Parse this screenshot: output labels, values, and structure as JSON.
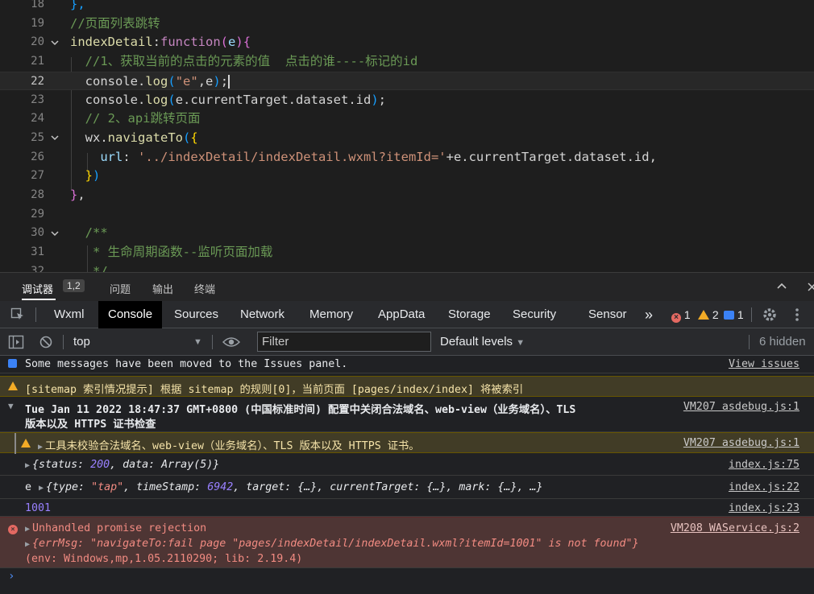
{
  "editor": {
    "lines": [
      {
        "n": "18",
        "tokens": [
          {
            "t": "},",
            "c": "t-b3"
          }
        ]
      },
      {
        "n": "19",
        "tokens": [
          {
            "t": "//页面列表跳转",
            "c": "t-cm"
          }
        ]
      },
      {
        "n": "20",
        "fold": true,
        "tokens": [
          {
            "t": "indexDetail",
            "c": "t-fn"
          },
          {
            "t": ":",
            "c": "t-txt"
          },
          {
            "t": "function",
            "c": "t-kw"
          },
          {
            "t": "(",
            "c": "t-b2"
          },
          {
            "t": "e",
            "c": "t-var"
          },
          {
            "t": ")",
            "c": "t-b2"
          },
          {
            "t": "{",
            "c": "t-b2"
          }
        ]
      },
      {
        "n": "21",
        "tokens": [
          {
            "t": "  //1、获取当前的点击的元素的值  点击的谁----标记的id",
            "c": "t-cm"
          }
        ]
      },
      {
        "n": "22",
        "current": true,
        "tokens": [
          {
            "t": "  console",
            "c": "t-txt"
          },
          {
            "t": ".",
            "c": "t-txt"
          },
          {
            "t": "log",
            "c": "t-fn"
          },
          {
            "t": "(",
            "c": "t-b3"
          },
          {
            "t": "\"e\"",
            "c": "t-str"
          },
          {
            "t": ",e",
            "c": "t-txt"
          },
          {
            "t": ")",
            "c": "t-b3"
          },
          {
            "t": ";",
            "c": "t-txt"
          }
        ]
      },
      {
        "n": "23",
        "tokens": [
          {
            "t": "  console",
            "c": "t-txt"
          },
          {
            "t": ".",
            "c": "t-txt"
          },
          {
            "t": "log",
            "c": "t-fn"
          },
          {
            "t": "(",
            "c": "t-b3"
          },
          {
            "t": "e.currentTarget.dataset.id",
            "c": "t-txt"
          },
          {
            "t": ")",
            "c": "t-b3"
          },
          {
            "t": ";",
            "c": "t-txt"
          }
        ]
      },
      {
        "n": "24",
        "tokens": [
          {
            "t": "  // 2、api跳转页面",
            "c": "t-cm"
          }
        ]
      },
      {
        "n": "25",
        "fold": true,
        "tokens": [
          {
            "t": "  wx",
            "c": "t-txt"
          },
          {
            "t": ".",
            "c": "t-txt"
          },
          {
            "t": "navigateTo",
            "c": "t-fn"
          },
          {
            "t": "(",
            "c": "t-b3"
          },
          {
            "t": "{",
            "c": "t-b1"
          }
        ]
      },
      {
        "n": "26",
        "tokens": [
          {
            "t": "    url",
            "c": "t-var"
          },
          {
            "t": ": ",
            "c": "t-txt"
          },
          {
            "t": "'../indexDetail/indexDetail.wxml?itemId='",
            "c": "t-str"
          },
          {
            "t": "+e.currentTarget.dataset.id,",
            "c": "t-txt"
          }
        ]
      },
      {
        "n": "27",
        "tokens": [
          {
            "t": "  }",
            "c": "t-b1"
          },
          {
            "t": ")",
            "c": "t-b3"
          }
        ]
      },
      {
        "n": "28",
        "tokens": [
          {
            "t": "}",
            "c": "t-b2"
          },
          {
            "t": ",",
            "c": "t-txt"
          }
        ]
      },
      {
        "n": "29",
        "tokens": []
      },
      {
        "n": "30",
        "fold": true,
        "tokens": [
          {
            "t": "  /**",
            "c": "t-cm"
          }
        ]
      },
      {
        "n": "31",
        "tokens": [
          {
            "t": "   * 生命周期函数--监听页面加载",
            "c": "t-cm"
          }
        ]
      },
      {
        "n": "32",
        "tokens": [
          {
            "t": "   */",
            "c": "t-cm"
          }
        ]
      }
    ]
  },
  "panel": {
    "tab_debugger": "调试器",
    "tab_debugger_badge": "1,2",
    "tab_problems": "问题",
    "tab_output": "输出",
    "tab_terminal": "终端"
  },
  "devtools": {
    "tabs": [
      "Wxml",
      "Console",
      "Sources",
      "Network",
      "Memory",
      "AppData",
      "Storage",
      "Security",
      "Sensor"
    ],
    "more": "»",
    "errors": "1",
    "warnings": "2",
    "infos": "1"
  },
  "toolbar": {
    "context": "top",
    "filter_placeholder": "Filter",
    "levels": "Default levels",
    "hidden": "6 hidden"
  },
  "console": {
    "m1_text": "Some messages have been moved to the Issues panel.",
    "m1_src": "View issues",
    "m2_text": "[sitemap 索引情况提示] 根据 sitemap 的规则[0]，当前页面 [pages/index/index] 将被索引",
    "m3_line1": "Tue Jan 11 2022 18:47:37 GMT+0800 (中国标准时间) 配置中关闭合法域名、web-view（业务域名）、TLS",
    "m3_line2": "版本以及 HTTPS 证书检查",
    "m3_src": "VM207 asdebug.js:1",
    "m4_text": "工具未校验合法域名、web-view（业务域名）、TLS 版本以及 HTTPS 证书。",
    "m4_src": "VM207 asdebug.js:1",
    "m5_pre": "{status: ",
    "m5_num": "200",
    "m5_post": ", data: Array(5)}",
    "m5_src": "index.js:75",
    "m6_label": "e",
    "m6_pre": "{type: ",
    "m6_str": "\"tap\"",
    "m6_mid": ", timeStamp: ",
    "m6_num": "6942",
    "m6_post": ", target: {…}, currentTarget: {…}, mark: {…}, …}",
    "m6_src": "index.js:22",
    "m7_text": "1001",
    "m7_src": "index.js:23",
    "m8_line1": "Unhandled promise rejection",
    "m8_line2_pre": "{errMsg: ",
    "m8_line2_str": "\"navigateTo:fail page \"pages/indexDetail/indexDetail.wxml?itemId=1001\" is not found\"",
    "m8_line2_post": "}",
    "m8_line3": "(env: Windows,mp,1.05.2110290; lib: 2.19.4)",
    "m8_src": "VM208 WAService.js:2",
    "prompt": "›"
  }
}
